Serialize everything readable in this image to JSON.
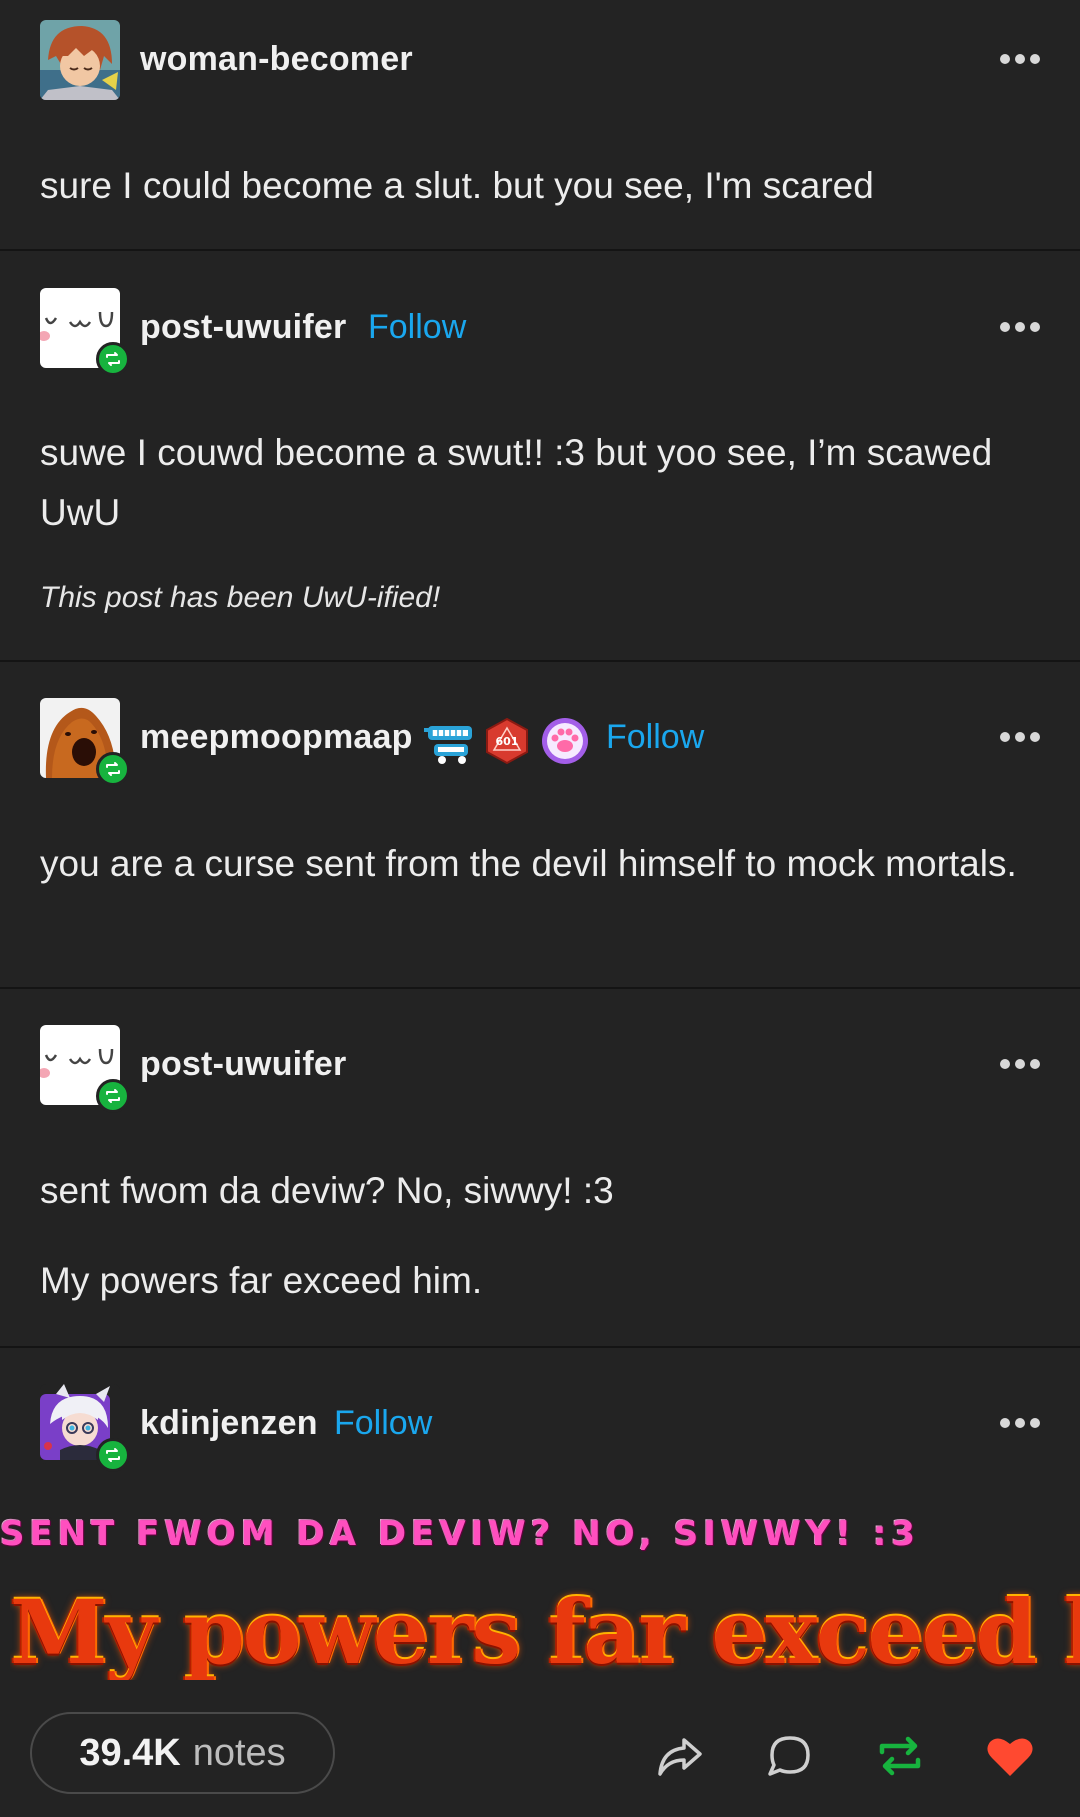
{
  "posts": [
    {
      "username": "woman-becomer",
      "follow": "",
      "text": "sure I could become a slut. but you see, I'm scared"
    },
    {
      "username": "post-uwuifer",
      "follow": "Follow",
      "text": "suwe I couwd become a swut!! :3 but yoo see, I’m scawed UwU",
      "note": "This post has been UwU-ified!"
    },
    {
      "username": "meepmoopmaap",
      "follow": "Follow",
      "badges": [
        "teeth-badge",
        "d20-badge",
        "paw-badge"
      ],
      "badge_d20_text": "601",
      "text": "you are a curse sent from the devil himself to mock mortals."
    },
    {
      "username": "post-uwuifer",
      "follow": "",
      "text_line1": "sent fwom da deviw? No, siwwy! :3",
      "text_line2": "My powers far exceed him."
    },
    {
      "username": "kdinjenzen",
      "follow": "Follow",
      "pink_text": "SENT FWOM DA DEVIW? NO, SIWWY! :3",
      "fire_text": "My powers far exceed him."
    }
  ],
  "footer": {
    "notes_count": "39.4K",
    "notes_label": "notes",
    "actions": [
      "share-icon",
      "comment-icon",
      "reblog-icon",
      "like-icon"
    ]
  },
  "colors": {
    "background": "#232323",
    "follow": "#1aa7ee",
    "reblog_badge": "#17b33e",
    "like": "#ff4930",
    "reblog_action": "#17b33e"
  }
}
